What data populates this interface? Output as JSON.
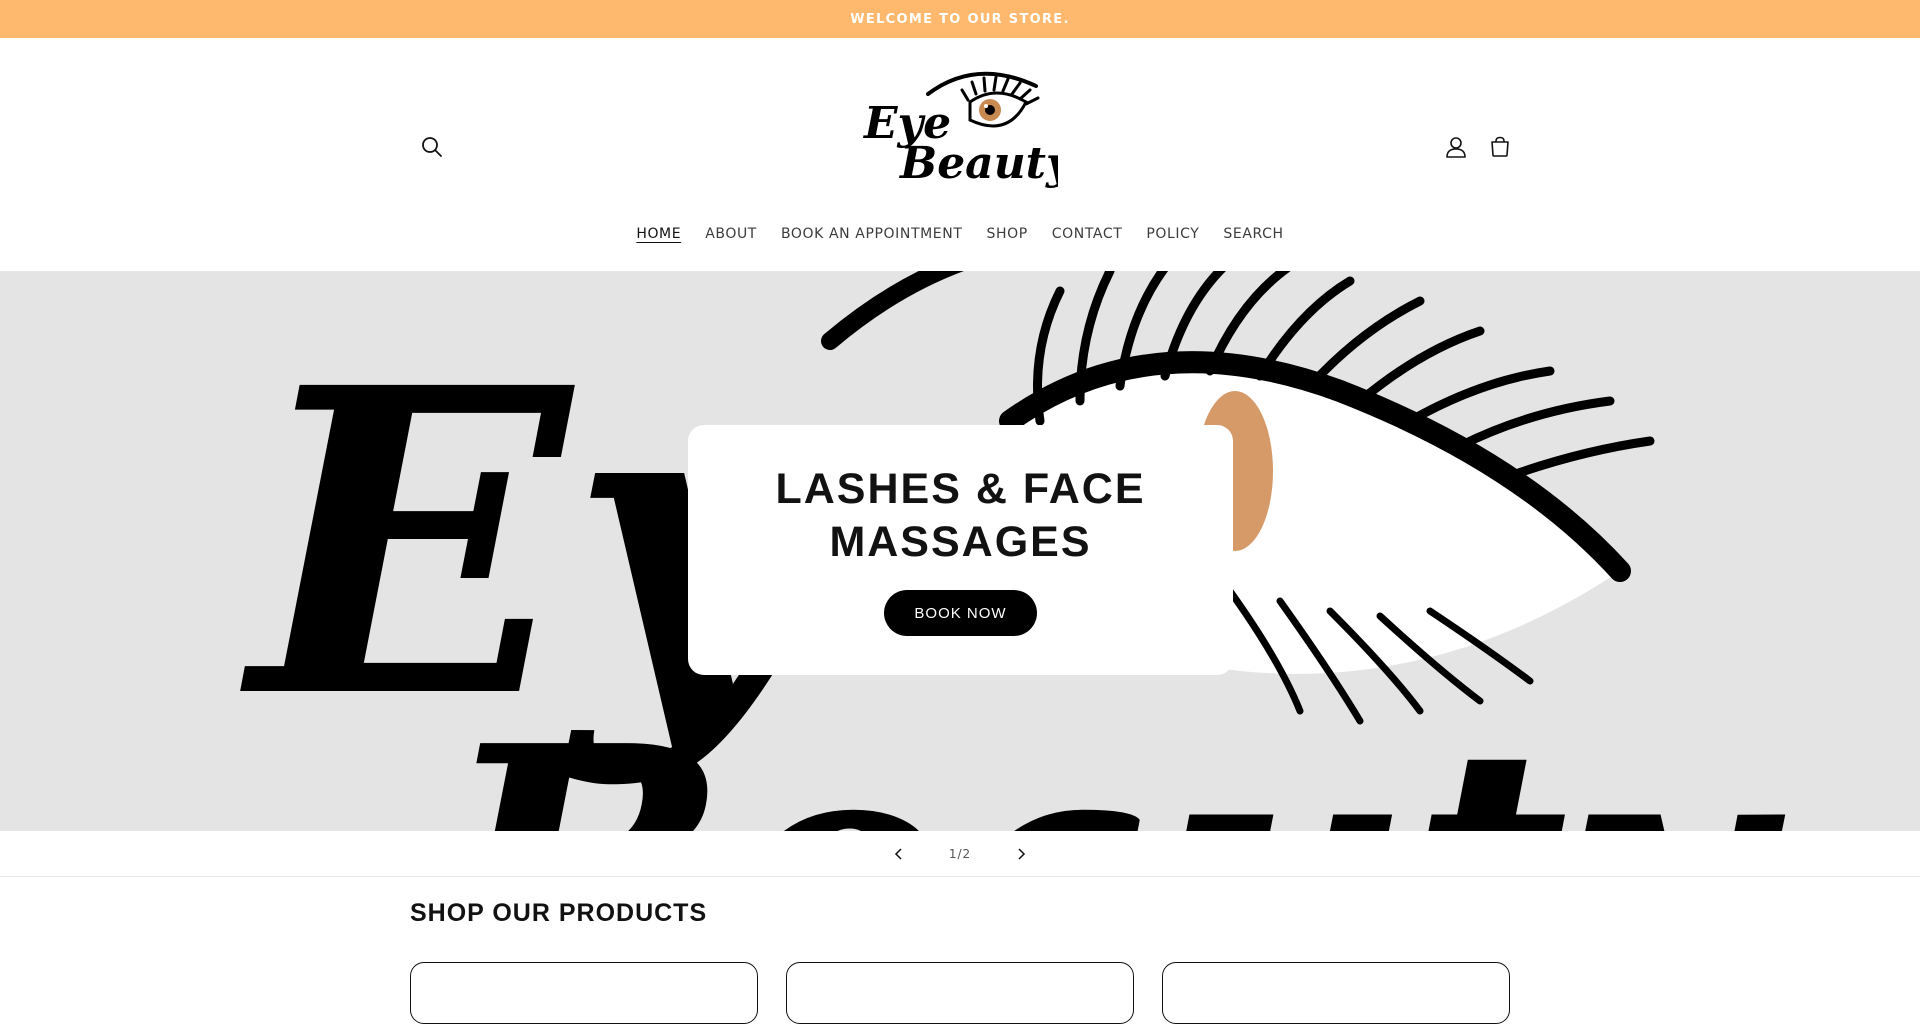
{
  "announcement": {
    "text": "WELCOME TO OUR STORE."
  },
  "header": {
    "logo_alt": "Eye Beauty",
    "icons": {
      "search": "search-icon",
      "account": "user-icon",
      "cart": "cart-icon"
    }
  },
  "nav": {
    "items": [
      {
        "label": "HOME",
        "active": true
      },
      {
        "label": "ABOUT"
      },
      {
        "label": "BOOK AN APPOINTMENT"
      },
      {
        "label": "SHOP"
      },
      {
        "label": "CONTACT"
      },
      {
        "label": "POLICY"
      },
      {
        "label": "SEARCH"
      }
    ]
  },
  "hero": {
    "title": "LASHES & FACE\nMASSAGES",
    "button_label": "BOOK NOW"
  },
  "slider": {
    "counter": "1/2"
  },
  "products": {
    "heading": "SHOP OUR PRODUCTS"
  },
  "colors": {
    "announcement_bg": "#ffb96e",
    "hero_bg": "#e4e4e4",
    "button_bg": "#000000"
  }
}
